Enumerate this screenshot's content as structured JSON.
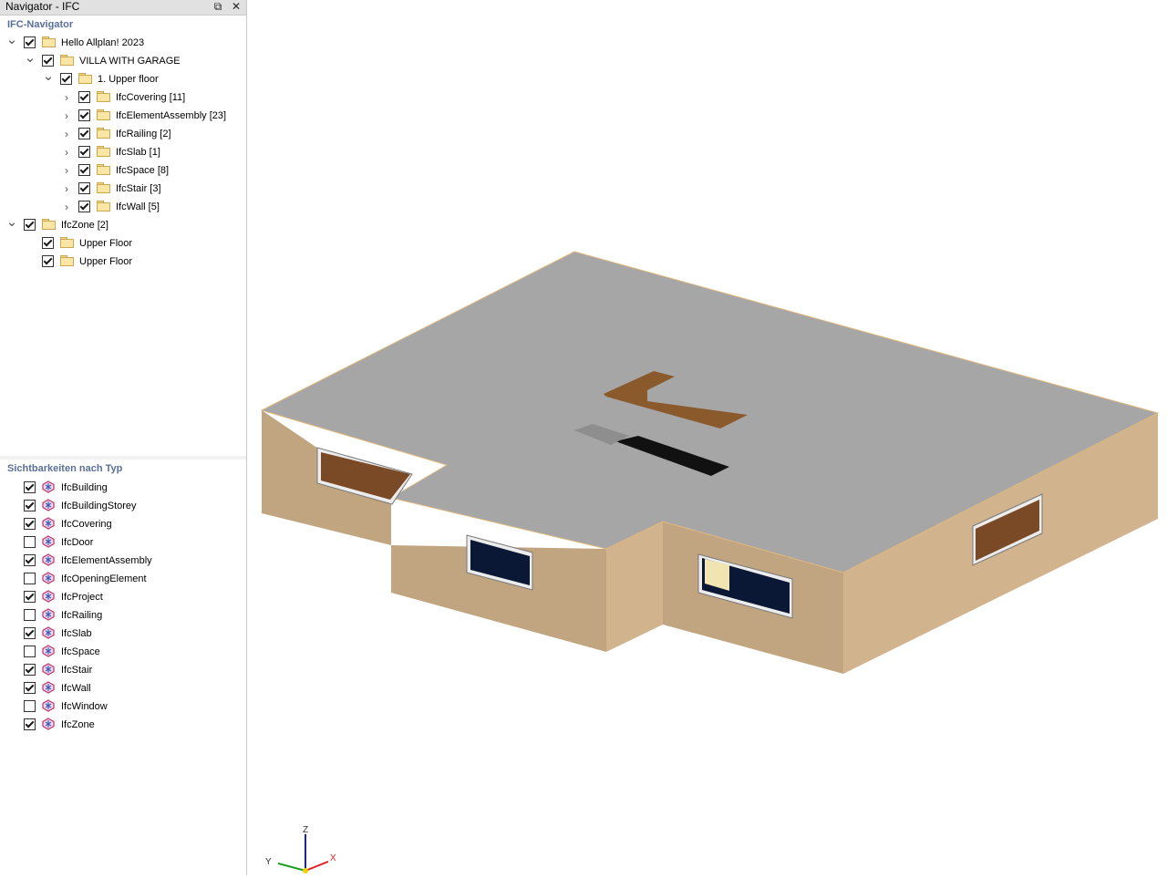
{
  "panel": {
    "title": "Navigator - IFC",
    "float_icon": "⧉",
    "close_icon": "✕"
  },
  "ifc_navigator": {
    "title": "IFC-Navigator",
    "items": [
      {
        "label": "Hello Allplan! 2023",
        "expanded": true,
        "checked": true
      },
      {
        "label": "VILLA WITH GARAGE",
        "expanded": true,
        "checked": true
      },
      {
        "label": "1. Upper floor",
        "expanded": true,
        "checked": true
      },
      {
        "label": "IfcCovering [11]",
        "expanded": false,
        "checked": true
      },
      {
        "label": "IfcElementAssembly [23]",
        "expanded": false,
        "checked": true
      },
      {
        "label": "IfcRailing [2]",
        "expanded": false,
        "checked": true
      },
      {
        "label": "IfcSlab [1]",
        "expanded": false,
        "checked": true
      },
      {
        "label": "IfcSpace [8]",
        "expanded": false,
        "checked": true
      },
      {
        "label": "IfcStair [3]",
        "expanded": false,
        "checked": true
      },
      {
        "label": "IfcWall [5]",
        "expanded": false,
        "checked": true
      },
      {
        "label": "IfcZone [2]",
        "expanded": true,
        "checked": true
      },
      {
        "label": "Upper Floor",
        "checked": true
      },
      {
        "label": "Upper Floor",
        "checked": true
      }
    ]
  },
  "visibility": {
    "title": "Sichtbarkeiten nach Typ",
    "items": [
      {
        "label": "IfcBuilding",
        "checked": true
      },
      {
        "label": "IfcBuildingStorey",
        "checked": true
      },
      {
        "label": "IfcCovering",
        "checked": true
      },
      {
        "label": "IfcDoor",
        "checked": false
      },
      {
        "label": "IfcElementAssembly",
        "checked": true
      },
      {
        "label": "IfcOpeningElement",
        "checked": false
      },
      {
        "label": "IfcProject",
        "checked": true
      },
      {
        "label": "IfcRailing",
        "checked": false
      },
      {
        "label": "IfcSlab",
        "checked": true
      },
      {
        "label": "IfcSpace",
        "checked": false
      },
      {
        "label": "IfcStair",
        "checked": true
      },
      {
        "label": "IfcWall",
        "checked": true
      },
      {
        "label": "IfcWindow",
        "checked": false
      },
      {
        "label": "IfcZone",
        "checked": true
      }
    ]
  },
  "axes": {
    "x": "X",
    "y": "Y",
    "z": "Z"
  },
  "colors": {
    "roof": "#a6a6a6",
    "wall_left": "#c1a581",
    "wall_right": "#d1b48d",
    "x_axis": "#e02020",
    "y_axis": "#20a020",
    "z_axis": "#1a2a8a"
  }
}
